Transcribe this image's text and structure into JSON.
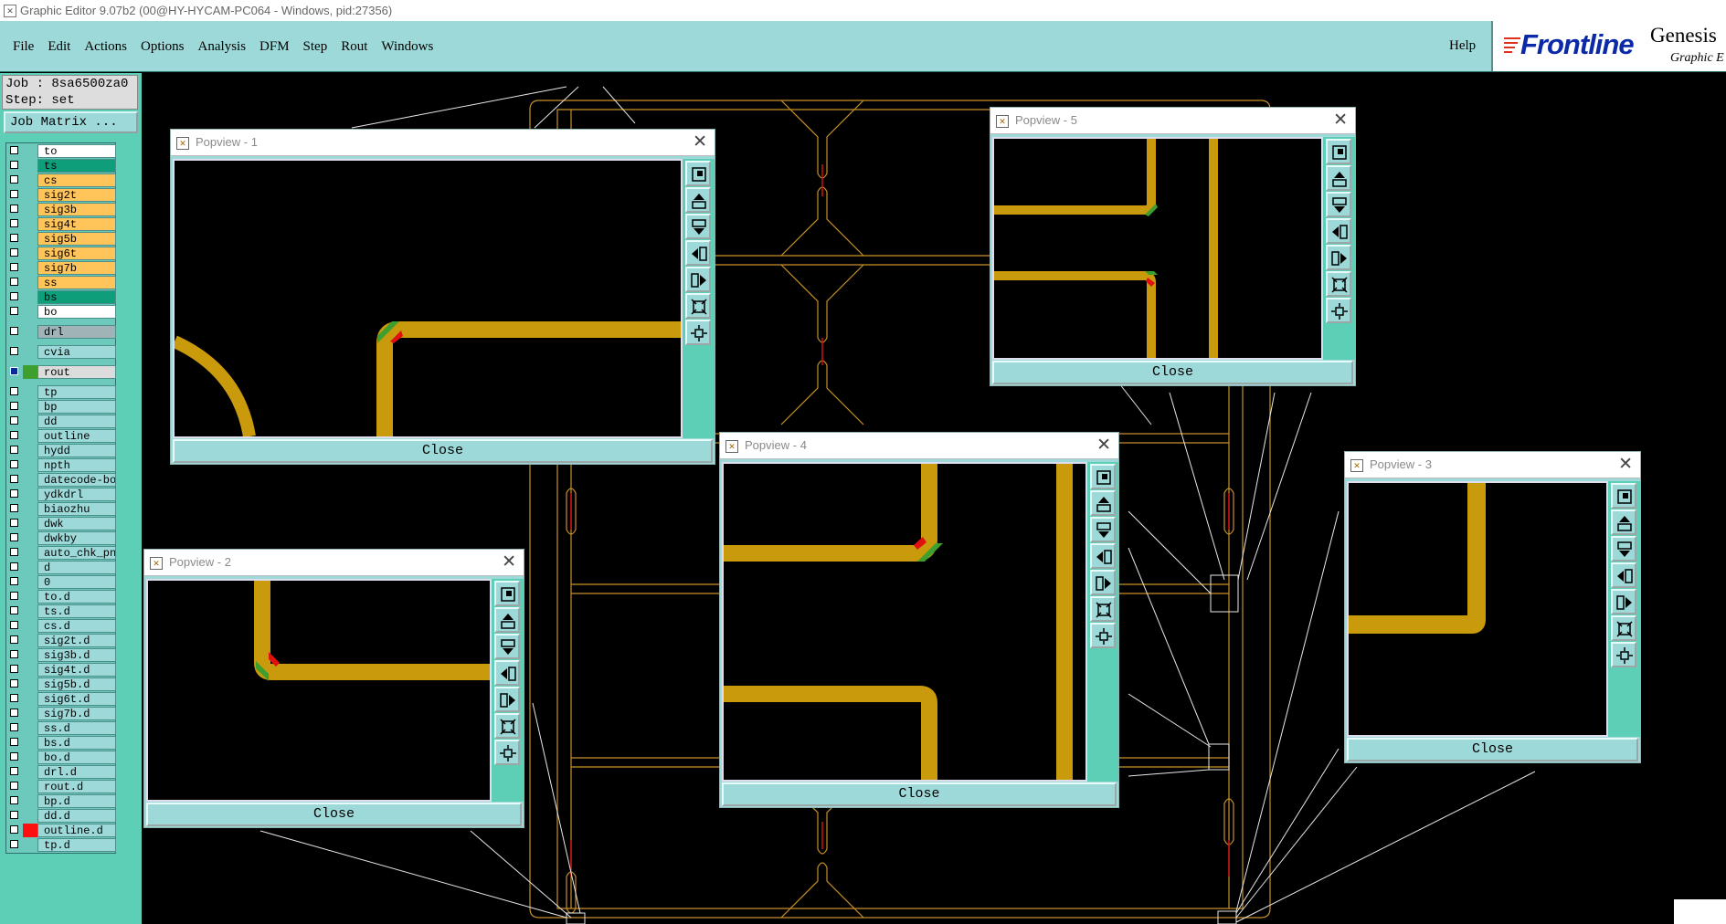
{
  "window": {
    "title": "Graphic Editor 9.07b2 (00@HY-HYCAM-PC064 - Windows, pid:27356)"
  },
  "menu": {
    "items": [
      "File",
      "Edit",
      "Actions",
      "Options",
      "Analysis",
      "DFM",
      "Step",
      "Rout",
      "Windows"
    ],
    "help": "Help"
  },
  "brand": {
    "logo": "Frontline",
    "product": "Genesis",
    "subtitle": "Graphic E"
  },
  "job": {
    "job_line": "Job : 8sa6500za0",
    "step_line": "Step: set",
    "matrix_button": "Job Matrix ..."
  },
  "layers": [
    {
      "name": "to",
      "color": "#ffffff"
    },
    {
      "name": "ts",
      "color": "#0e9e7a"
    },
    {
      "name": "cs",
      "color": "#ffc45a"
    },
    {
      "name": "sig2t",
      "color": "#ffc45a"
    },
    {
      "name": "sig3b",
      "color": "#ffc45a"
    },
    {
      "name": "sig4t",
      "color": "#ffc45a"
    },
    {
      "name": "sig5b",
      "color": "#ffc45a"
    },
    {
      "name": "sig6t",
      "color": "#ffc45a"
    },
    {
      "name": "sig7b",
      "color": "#ffc45a"
    },
    {
      "name": "ss",
      "color": "#ffc45a"
    },
    {
      "name": "bs",
      "color": "#0e9e7a"
    },
    {
      "name": "bo",
      "color": "#ffffff"
    },
    {
      "name": "drl",
      "color": "#a0b4b8",
      "gap": true
    },
    {
      "name": "cvia",
      "color": "#9dd9d8",
      "gap": true
    },
    {
      "name": "rout",
      "color": "#dcdcdc",
      "gap": true,
      "active": true,
      "swatch": "#3da02e"
    },
    {
      "name": "tp",
      "color": "#9dd9d8",
      "gap": true
    },
    {
      "name": "bp",
      "color": "#9dd9d8"
    },
    {
      "name": "dd",
      "color": "#9dd9d8"
    },
    {
      "name": "outline",
      "color": "#9dd9d8"
    },
    {
      "name": "hydd",
      "color": "#9dd9d8"
    },
    {
      "name": "npth",
      "color": "#9dd9d8"
    },
    {
      "name": "datecode-bo",
      "color": "#9dd9d8"
    },
    {
      "name": "ydkdrl",
      "color": "#9dd9d8"
    },
    {
      "name": "biaozhu",
      "color": "#9dd9d8"
    },
    {
      "name": "dwk",
      "color": "#9dd9d8"
    },
    {
      "name": "dwkby",
      "color": "#9dd9d8"
    },
    {
      "name": "auto_chk_pn",
      "color": "#9dd9d8"
    },
    {
      "name": "d",
      "color": "#9dd9d8"
    },
    {
      "name": "0",
      "color": "#9dd9d8"
    },
    {
      "name": "to.d",
      "color": "#9dd9d8"
    },
    {
      "name": "ts.d",
      "color": "#9dd9d8"
    },
    {
      "name": "cs.d",
      "color": "#9dd9d8"
    },
    {
      "name": "sig2t.d",
      "color": "#9dd9d8"
    },
    {
      "name": "sig3b.d",
      "color": "#9dd9d8"
    },
    {
      "name": "sig4t.d",
      "color": "#9dd9d8"
    },
    {
      "name": "sig5b.d",
      "color": "#9dd9d8"
    },
    {
      "name": "sig6t.d",
      "color": "#9dd9d8"
    },
    {
      "name": "sig7b.d",
      "color": "#9dd9d8"
    },
    {
      "name": "ss.d",
      "color": "#9dd9d8"
    },
    {
      "name": "bs.d",
      "color": "#9dd9d8"
    },
    {
      "name": "bo.d",
      "color": "#9dd9d8"
    },
    {
      "name": "drl.d",
      "color": "#9dd9d8"
    },
    {
      "name": "rout.d",
      "color": "#9dd9d8"
    },
    {
      "name": "bp.d",
      "color": "#9dd9d8"
    },
    {
      "name": "dd.d",
      "color": "#9dd9d8"
    },
    {
      "name": "outline.d",
      "color": "#9dd9d8",
      "swatch": "#ff1010"
    },
    {
      "name": "tp.d",
      "color": "#9dd9d8"
    }
  ],
  "popviews": [
    {
      "title": "Popview - 1",
      "close_label": "Close"
    },
    {
      "title": "Popview - 2",
      "close_label": "Close"
    },
    {
      "title": "Popview - 3",
      "close_label": "Close"
    },
    {
      "title": "Popview - 4",
      "close_label": "Close"
    },
    {
      "title": "Popview - 5",
      "close_label": "Close"
    }
  ],
  "popview_tools": [
    "fit-icon",
    "pan-up-icon",
    "pan-down-icon",
    "pan-left-icon",
    "pan-right-icon",
    "zoom-in-icon",
    "zoom-out-icon"
  ],
  "colors": {
    "trace": "#c89a0c",
    "outline": "#c8902a",
    "accent": "#9dd9d8",
    "panel": "#5ccfb6"
  }
}
